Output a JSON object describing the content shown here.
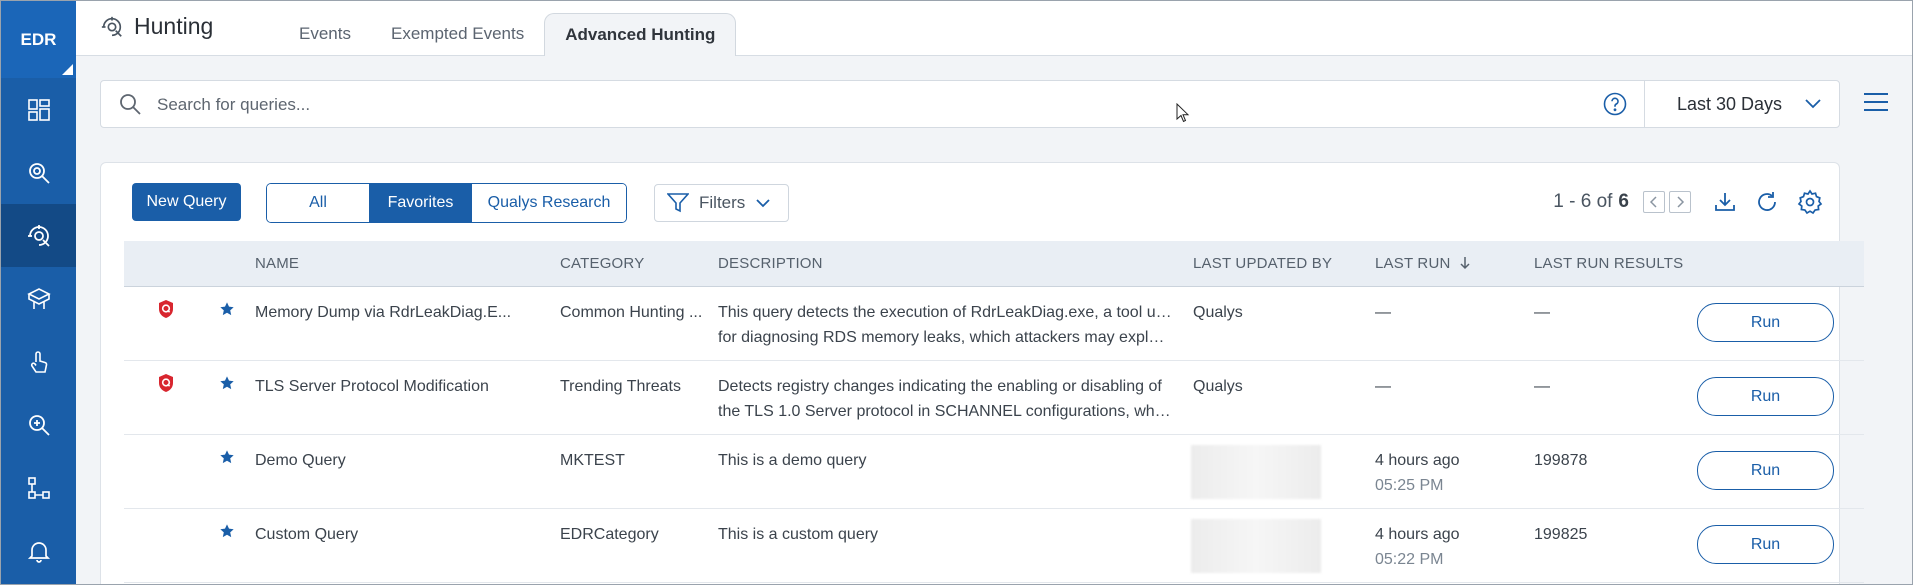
{
  "sidebar": {
    "brand": "EDR",
    "items": [
      {
        "icon": "dashboard-icon"
      },
      {
        "icon": "investigate-icon"
      },
      {
        "icon": "hunting-icon",
        "active": true
      },
      {
        "icon": "assets-icon"
      },
      {
        "icon": "response-icon"
      },
      {
        "icon": "threat-search-icon"
      },
      {
        "icon": "hierarchy-icon"
      },
      {
        "icon": "bell-icon"
      }
    ]
  },
  "header": {
    "title": "Hunting",
    "tabs": [
      {
        "label": "Events"
      },
      {
        "label": "Exempted Events"
      },
      {
        "label": "Advanced Hunting",
        "active": true
      }
    ]
  },
  "search": {
    "placeholder": "Search for queries...",
    "date_range": "Last 30 Days"
  },
  "toolbar": {
    "new_query_label": "New Query",
    "segments": [
      "All",
      "Favorites",
      "Qualys Research"
    ],
    "active_segment": "Favorites",
    "filters_label": "Filters",
    "pagination": {
      "range": "1 - 6 of",
      "total": "6"
    }
  },
  "table": {
    "columns": [
      "NAME",
      "CATEGORY",
      "DESCRIPTION",
      "LAST UPDATED BY",
      "LAST RUN",
      "LAST RUN RESULTS"
    ],
    "sort_column": "LAST RUN",
    "run_label": "Run",
    "rows": [
      {
        "qualys_badge": true,
        "favorite": true,
        "name": "Memory Dump via RdrLeakDiag.E...",
        "category": "Common Hunting ...",
        "description_line1": "This query detects the execution of RdrLeakDiag.exe, a tool used",
        "description_line2": "for diagnosing RDS memory leaks, which attackers may exploit...",
        "updated_by": "Qualys",
        "last_run": "—",
        "last_run_time": "",
        "results": "—"
      },
      {
        "qualys_badge": true,
        "favorite": true,
        "name": "TLS Server Protocol Modification",
        "category": "Trending Threats",
        "description_line1": "Detects registry changes indicating the enabling or disabling of",
        "description_line2": "the TLS 1.0 Server protocol in SCHANNEL configurations, which...",
        "updated_by": "Qualys",
        "last_run": "—",
        "last_run_time": "",
        "results": "—"
      },
      {
        "qualys_badge": false,
        "favorite": true,
        "name": "Demo Query",
        "category": "MKTEST",
        "description_line1": "This is a demo query",
        "description_line2": "",
        "updated_by": "",
        "last_run": "4 hours ago",
        "last_run_time": "05:25 PM",
        "results": "199878"
      },
      {
        "qualys_badge": false,
        "favorite": true,
        "name": "Custom Query",
        "category": "EDRCategory",
        "description_line1": "This is a custom query",
        "description_line2": "",
        "updated_by": "",
        "last_run": "4 hours ago",
        "last_run_time": "05:22 PM",
        "results": "199825"
      }
    ]
  },
  "colors": {
    "brand": "#1a5ea8",
    "sidebar_active": "#134a86",
    "badge_red": "#d8262f"
  }
}
